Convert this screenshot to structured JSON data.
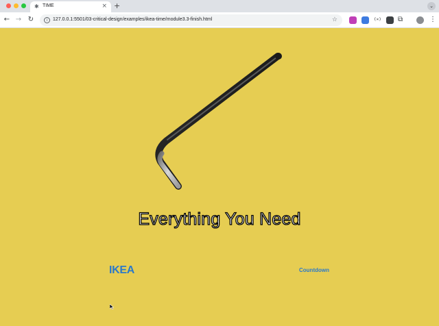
{
  "browser": {
    "tab": {
      "title": "TIME",
      "favicon": "ikea-time-favicon",
      "close_glyph": "×"
    },
    "new_tab_glyph": "+",
    "tab_list_glyph": "⌄",
    "nav": {
      "back_glyph": "←",
      "forward_glyph": "→",
      "reload_glyph": "↻"
    },
    "address": {
      "info_glyph": "i",
      "url": "127.0.0.1:5501/03-critical-design/examples/ikea-time/module3.3-finish.html",
      "star_glyph": "☆"
    },
    "extensions": [
      "extension-icon",
      "translate-extension-icon",
      "code-extension-icon",
      "puzzle-extension-icon"
    ],
    "menu_glyph": "⋮",
    "puzzle_glyph": "⧉",
    "ext3_text": "(×)"
  },
  "page": {
    "background_color": "#e6cd52",
    "headline": "Everything You Need",
    "logo": "IKEA",
    "logo_color": "#2b79c9",
    "link": "Countdown"
  }
}
